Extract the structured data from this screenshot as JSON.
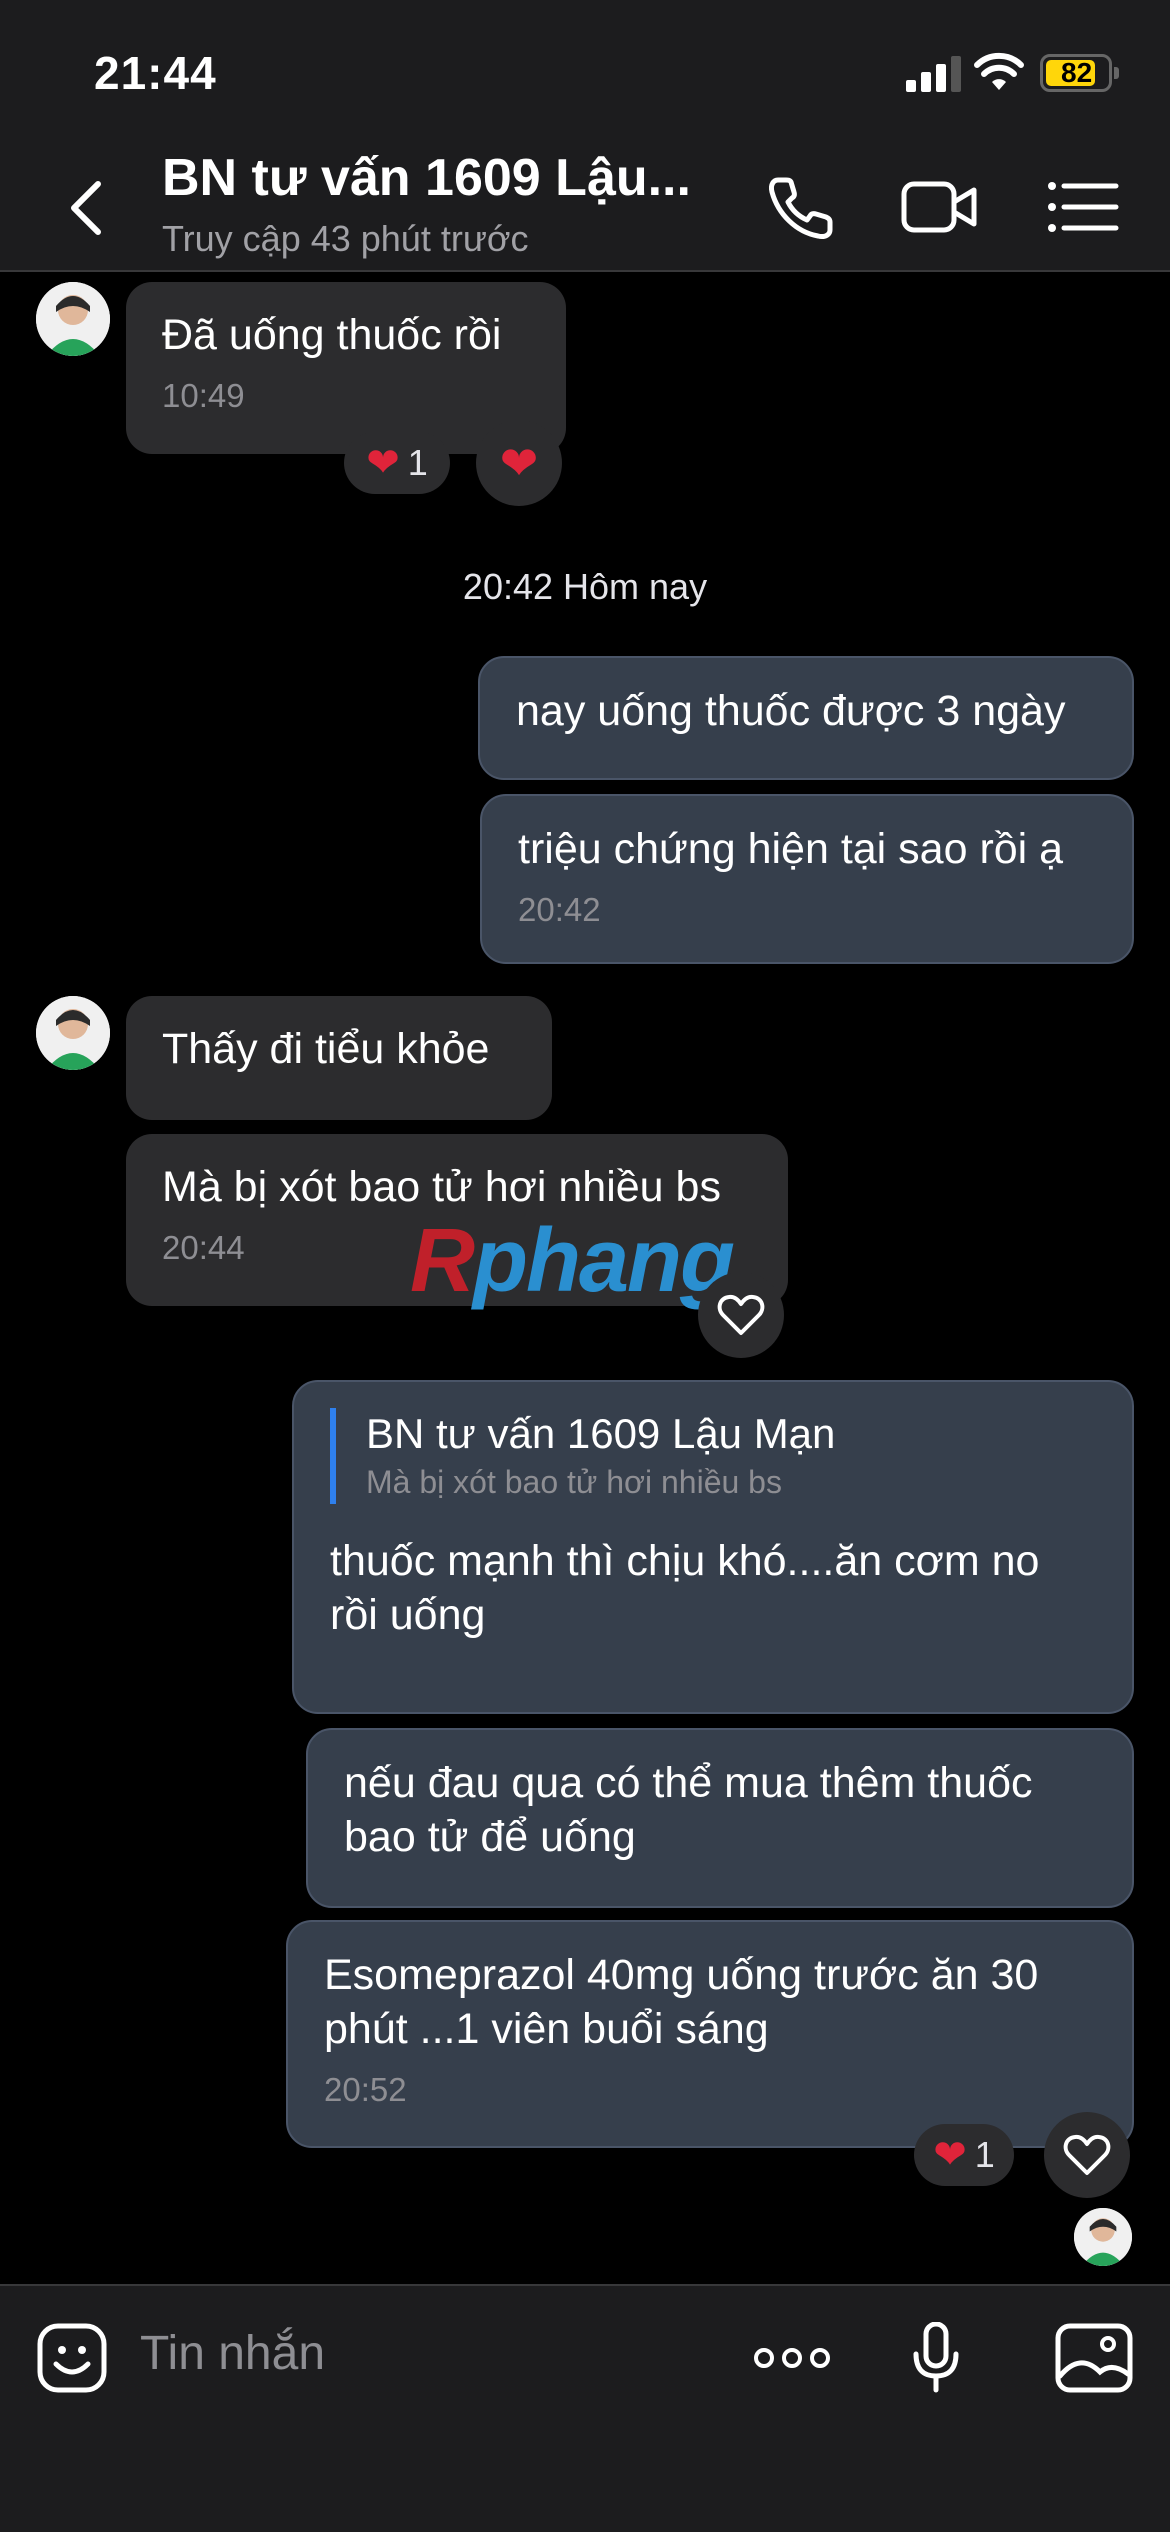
{
  "status_bar": {
    "time": "21:44",
    "battery": "82"
  },
  "header": {
    "title": "BN tư vấn 1609 Lậu...",
    "subtitle": "Truy cập 43 phút trước",
    "call_icon": "phone-icon",
    "video_icon": "video-camera-icon",
    "menu_icon": "list-menu-icon"
  },
  "messages": {
    "m1": {
      "text": "Đã uống thuốc rồi",
      "time": "10:49",
      "reaction_count": "1"
    },
    "divider": "20:42 Hôm nay",
    "m2": {
      "text": "nay uống thuốc được 3 ngày"
    },
    "m3": {
      "text": "triệu chứng hiện tại sao rồi ạ",
      "time": "20:42"
    },
    "m4": {
      "text": "Thấy đi tiểu khỏe"
    },
    "m5": {
      "text": "Mà bị xót bao tử hơi nhiều bs",
      "time": "20:44"
    },
    "m6": {
      "quote_name": "BN tư vấn 1609 Lậu Mạn",
      "quote_text": "Mà bị xót bao tử hơi nhiều bs",
      "text": "thuốc mạnh thì chịu khó....ăn cơm no rồi uống"
    },
    "m7": {
      "text": "nếu đau qua có thể mua thêm thuốc bao tử để uống"
    },
    "m8": {
      "text": "Esomeprazol 40mg uống trước ăn 30 phút ...1 viên buổi sáng",
      "time": "20:52",
      "reaction_count": "1"
    }
  },
  "watermark": {
    "r": "R",
    "rest": "phang"
  },
  "composer": {
    "placeholder": "Tin nhắn"
  },
  "colors": {
    "outgoing_bubble": "#363f4c",
    "incoming_bubble": "#2c2c2e",
    "heart": "#e0243a",
    "battery": "#ffd60a"
  }
}
